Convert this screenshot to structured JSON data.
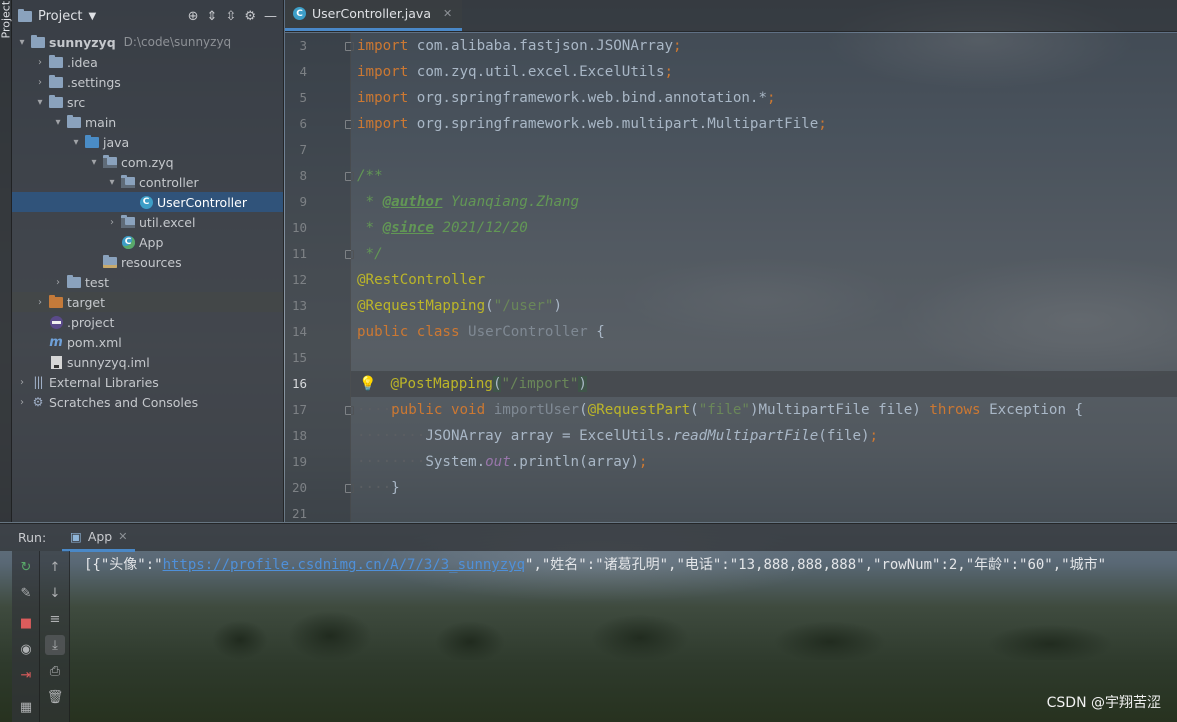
{
  "left_strip": {
    "tab_label": "Project"
  },
  "project_panel": {
    "title": "Project",
    "tree": [
      {
        "label": "sunnyzyq",
        "path": "D:\\code\\sunnyzyq",
        "icon": "module-folder-icon",
        "arrow": "▾",
        "indent": 0
      },
      {
        "label": ".idea",
        "icon": "folder-icon",
        "arrow": "›",
        "indent": 1
      },
      {
        "label": ".settings",
        "icon": "folder-icon",
        "arrow": "›",
        "indent": 1
      },
      {
        "label": "src",
        "icon": "folder-icon",
        "arrow": "▾",
        "indent": 1
      },
      {
        "label": "main",
        "icon": "folder-icon",
        "arrow": "▾",
        "indent": 2
      },
      {
        "label": "java",
        "icon": "source-folder-icon",
        "arrow": "▾",
        "indent": 3
      },
      {
        "label": "com.zyq",
        "icon": "package-icon",
        "arrow": "▾",
        "indent": 4
      },
      {
        "label": "controller",
        "icon": "package-icon",
        "arrow": "▾",
        "indent": 5
      },
      {
        "label": "UserController",
        "icon": "class-icon",
        "arrow": "",
        "indent": 6,
        "selected": true
      },
      {
        "label": "util.excel",
        "icon": "package-icon",
        "arrow": "›",
        "indent": 5
      },
      {
        "label": "App",
        "icon": "class-run-icon",
        "arrow": "",
        "indent": 5
      },
      {
        "label": "resources",
        "icon": "resources-folder-icon",
        "arrow": "",
        "indent": 4
      },
      {
        "label": "test",
        "icon": "folder-icon",
        "arrow": "›",
        "indent": 2
      },
      {
        "label": "target",
        "icon": "excluded-folder-icon",
        "arrow": "›",
        "indent": 1,
        "highlight": true
      },
      {
        "label": ".project",
        "icon": "eclipse-file-icon",
        "arrow": "",
        "indent": 1
      },
      {
        "label": "pom.xml",
        "icon": "maven-file-icon",
        "arrow": "",
        "indent": 1
      },
      {
        "label": "sunnyzyq.iml",
        "icon": "iml-file-icon",
        "arrow": "",
        "indent": 1
      },
      {
        "label": "External Libraries",
        "icon": "libraries-icon",
        "arrow": "›",
        "indent": 0
      },
      {
        "label": "Scratches and Consoles",
        "icon": "scratches-icon",
        "arrow": "›",
        "indent": 0
      }
    ]
  },
  "editor": {
    "tab_label": "UserController.java",
    "current_line": "16",
    "line_numbers": [
      "3",
      "4",
      "5",
      "6",
      "7",
      "8",
      "9",
      "10",
      "11",
      "12",
      "13",
      "14",
      "15",
      "16",
      "17",
      "18",
      "19",
      "20",
      "21"
    ]
  },
  "run_panel": {
    "label": "Run:",
    "tab_label": "App",
    "console_prefix": "[{\"头像\":\"",
    "console_link": "https://profile.csdnimg.cn/A/7/3/3_sunnyzyq",
    "console_suffix": "\",\"姓名\":\"诸葛孔明\",\"电话\":\"13,888,888,888\",\"rowNum\":2,\"年龄\":\"60\",\"城市\""
  },
  "watermark": "CSDN @宇翔苦涩"
}
